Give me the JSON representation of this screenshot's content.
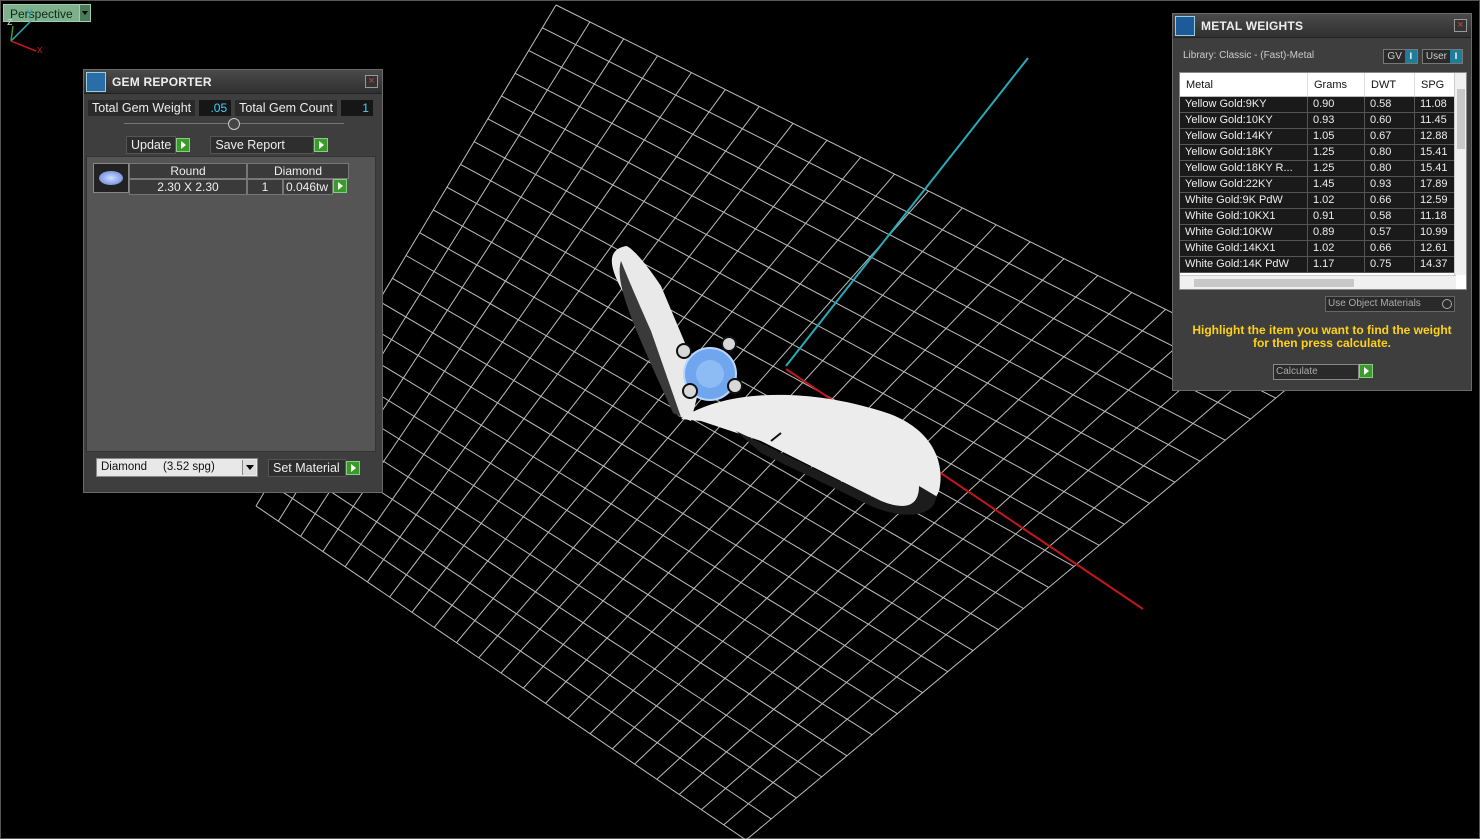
{
  "viewport": {
    "label": "Perspective"
  },
  "gem_reporter": {
    "title": "GEM REPORTER",
    "total_weight_label": "Total Gem Weight",
    "total_weight_value": ".05",
    "total_count_label": "Total Gem Count",
    "total_count_value": "1",
    "update_label": "Update",
    "save_report_label": "Save Report",
    "gem": {
      "shape": "Round",
      "material": "Diamond",
      "size": "2.30 X 2.30",
      "count": "1",
      "weight": "0.046tw"
    },
    "material_select": "Diamond     (3.52 spg)",
    "set_material_label": "Set Material"
  },
  "metal_weights": {
    "title": "METAL WEIGHTS",
    "library": "Library: Classic - (Fast)-Metal",
    "gv_label": "GV",
    "user_label": "User",
    "columns": [
      "Metal",
      "Grams",
      "DWT",
      "SPG"
    ],
    "rows": [
      [
        "Yellow Gold:9KY",
        "0.90",
        "0.58",
        "11.08"
      ],
      [
        "Yellow Gold:10KY",
        "0.93",
        "0.60",
        "11.45"
      ],
      [
        "Yellow Gold:14KY",
        "1.05",
        "0.67",
        "12.88"
      ],
      [
        "Yellow Gold:18KY",
        "1.25",
        "0.80",
        "15.41"
      ],
      [
        "Yellow Gold:18KY R...",
        "1.25",
        "0.80",
        "15.41"
      ],
      [
        "Yellow Gold:22KY",
        "1.45",
        "0.93",
        "17.89"
      ],
      [
        "White Gold:9K PdW",
        "1.02",
        "0.66",
        "12.59"
      ],
      [
        "White Gold:10KX1",
        "0.91",
        "0.58",
        "11.18"
      ],
      [
        "White Gold:10KW",
        "0.89",
        "0.57",
        "10.99"
      ],
      [
        "White Gold:14KX1",
        "1.02",
        "0.66",
        "12.61"
      ],
      [
        "White Gold:14K PdW",
        "1.17",
        "0.75",
        "14.37"
      ]
    ],
    "use_object_materials": "Use Object Materials",
    "hint": "Highlight the item you want to find the weight for then press calculate.",
    "calculate_label": "Calculate"
  },
  "axis_labels": {
    "x": "x",
    "y": "y",
    "z": "z"
  }
}
